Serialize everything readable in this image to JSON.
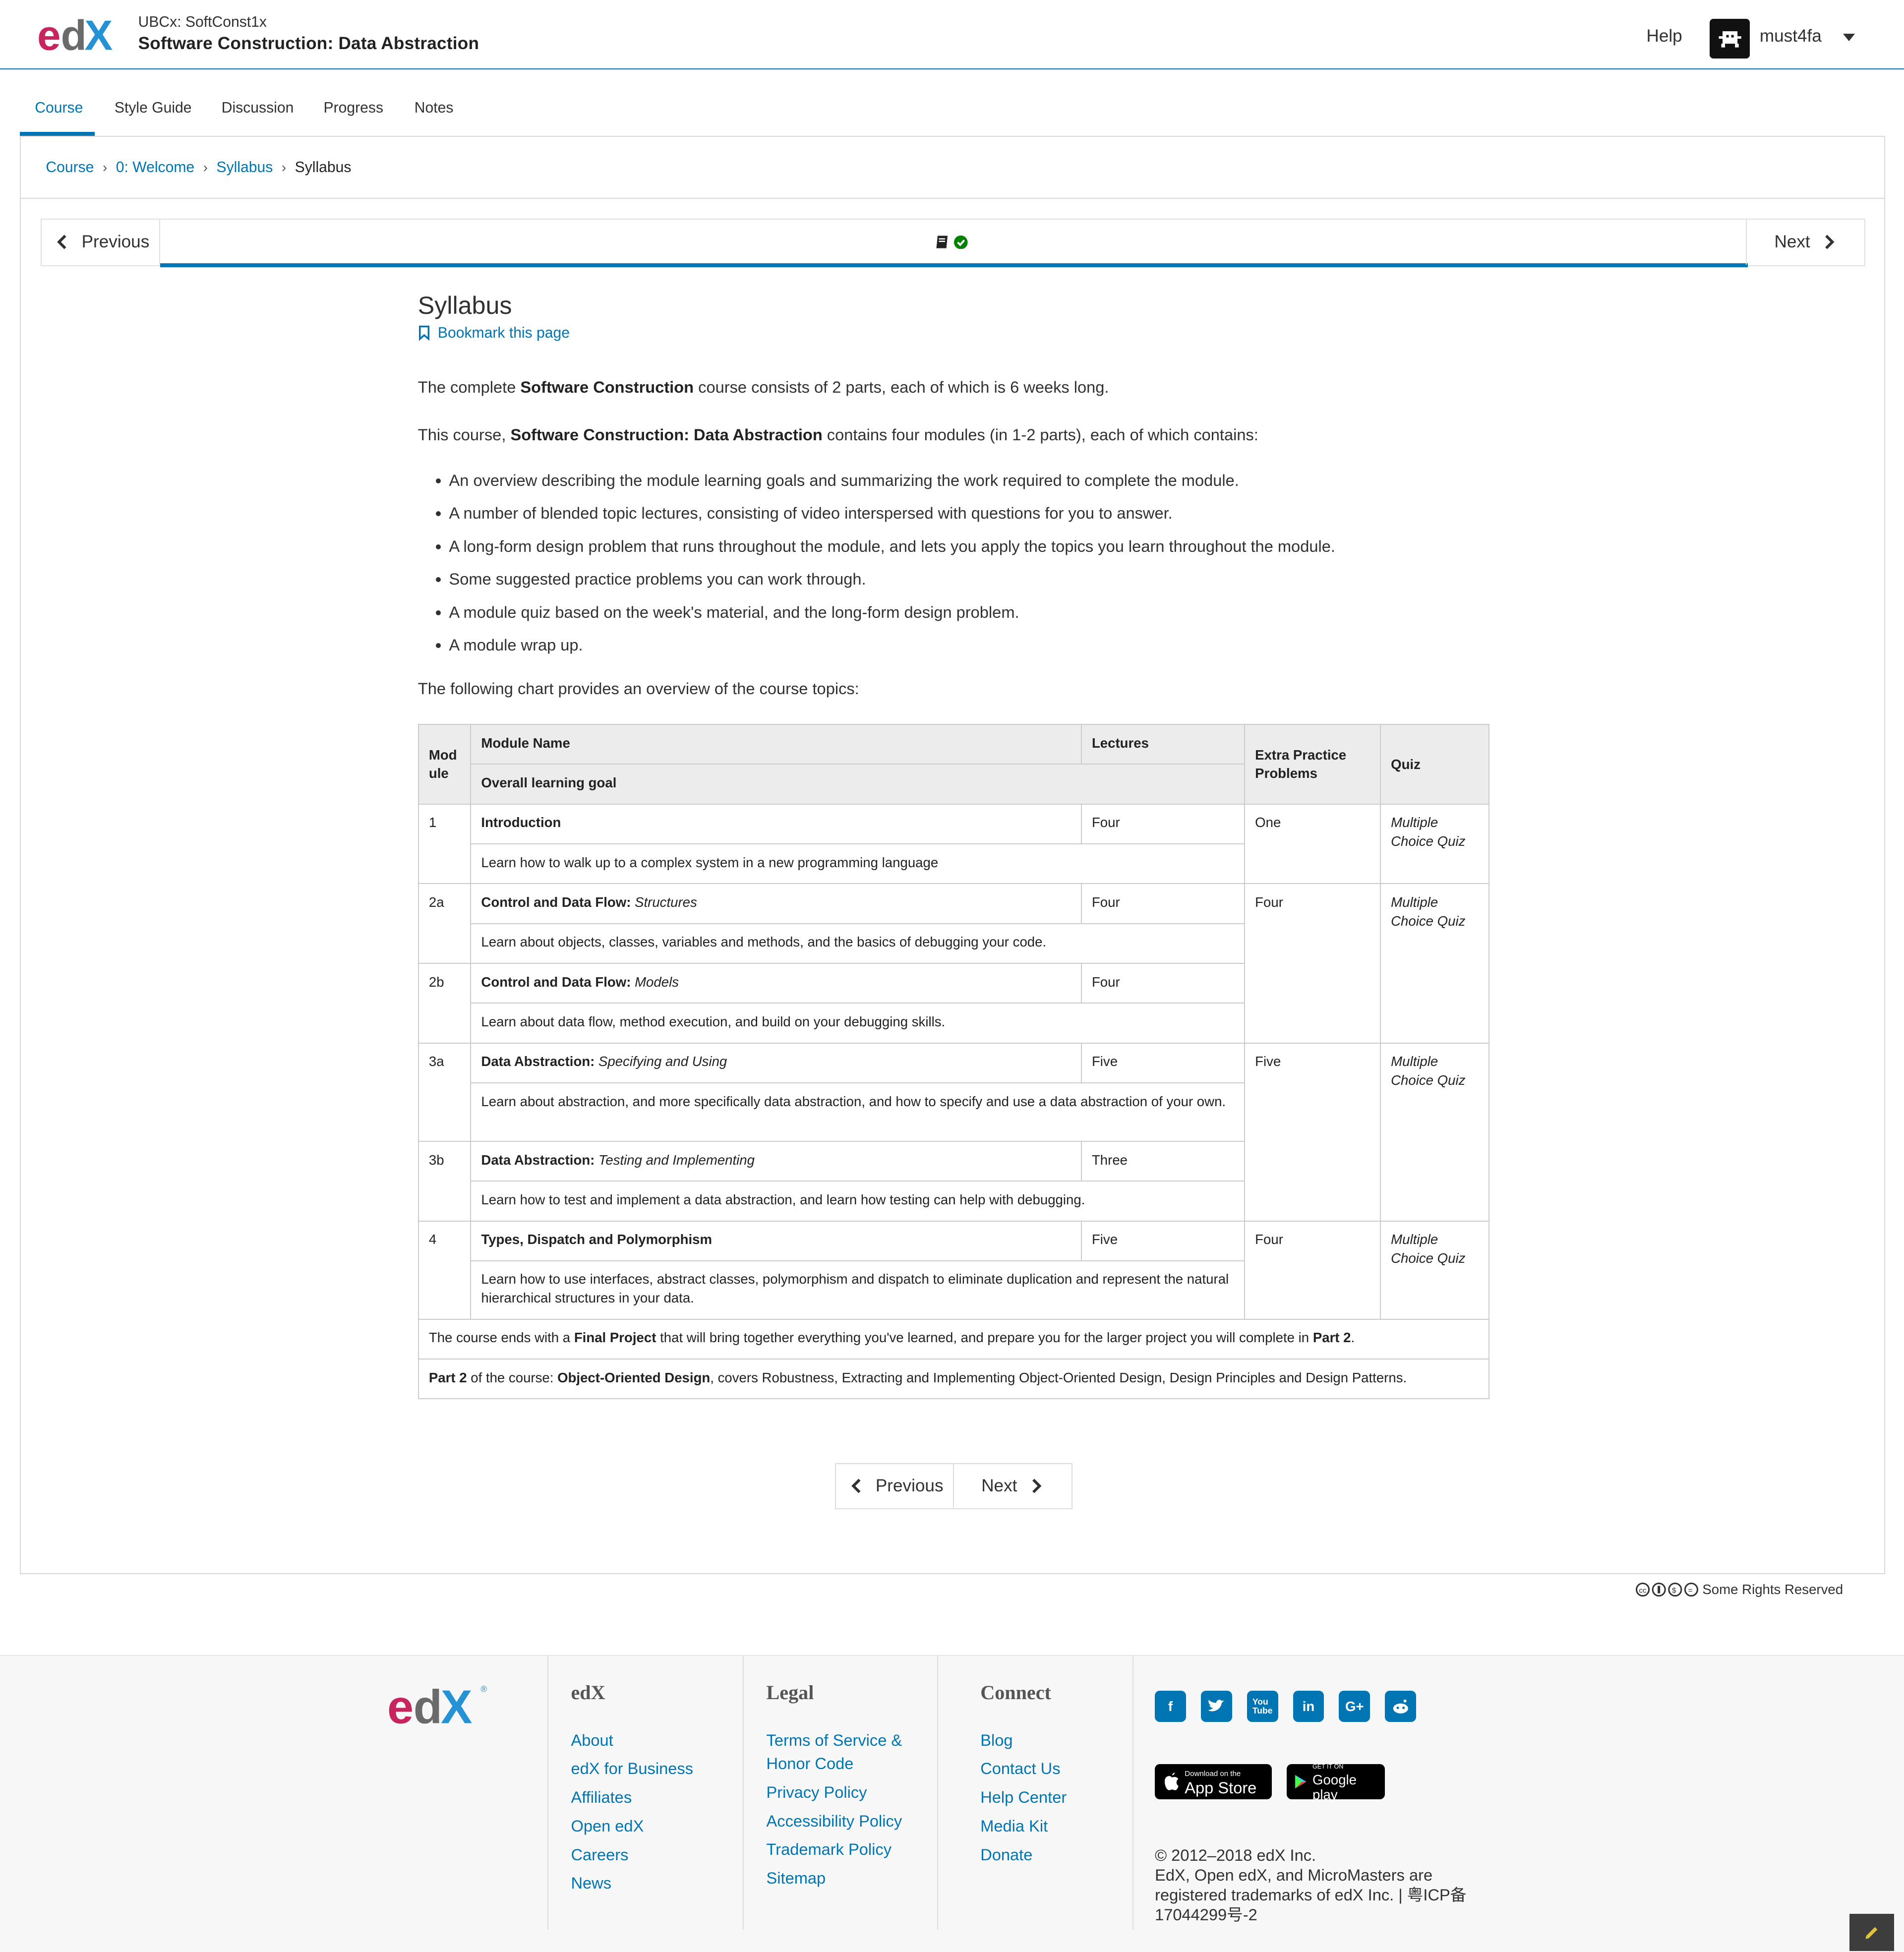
{
  "header": {
    "course_org": "UBCx: SoftConst1x",
    "course_title": "Software Construction: Data Abstraction",
    "help": "Help",
    "username": "must4fa"
  },
  "tabs": [
    "Course",
    "Style Guide",
    "Discussion",
    "Progress",
    "Notes"
  ],
  "breadcrumb": [
    "Course",
    "0: Welcome",
    "Syllabus",
    "Syllabus"
  ],
  "sequence_nav": {
    "previous": "Previous",
    "next": "Next"
  },
  "unit": {
    "title": "Syllabus",
    "bookmark": "Bookmark this page",
    "p1_pre": "The complete ",
    "p1_bold": "Software Construction",
    "p1_post": " course consists of 2 parts, each of which is 6 weeks long.",
    "p2_pre": "This course, ",
    "p2_bold": "Software Construction: Data Abstraction",
    "p2_post": " contains four modules (in 1-2 parts), each of which contains:",
    "bullets": [
      "An overview describing the module learning goals and summarizing the work required to complete the module.",
      "A number of blended topic lectures, consisting of video interspersed with questions for you to answer.",
      "A long-form design problem that runs throughout the module, and lets you apply the topics you learn throughout the module.",
      "Some suggested practice problems you can work through.",
      "A module quiz based on the week's material, and the long-form design problem.",
      "A module wrap up."
    ],
    "chart_intro": "The following chart provides an overview of the course topics:"
  },
  "table": {
    "headers": {
      "module": "Mod ule",
      "module_name": "Module Name",
      "lectures": "Lectures",
      "overall_goal": "Overall learning goal",
      "extra": "Extra Practice Problems",
      "quiz": "Quiz"
    },
    "rows": [
      {
        "mod": "1",
        "name_bold": "Introduction",
        "name_italic": "",
        "lectures": "Four",
        "goal": "Learn how to walk up to a complex system in a new programming language",
        "extra": "One",
        "quiz": "Multiple Choice Quiz"
      },
      {
        "mod": "2a",
        "name_bold": "Control and Data Flow: ",
        "name_italic": "Structures",
        "lectures": "Four",
        "goal": "Learn about objects, classes, variables and methods, and the basics of debugging your code.",
        "extra": "Four",
        "quiz": "Multiple Choice Quiz"
      },
      {
        "mod": "2b",
        "name_bold": "Control and Data Flow: ",
        "name_italic": "Models",
        "lectures": "Four",
        "goal": "Learn about data flow, method execution, and build on your debugging skills."
      },
      {
        "mod": "3a",
        "name_bold": "Data Abstraction: ",
        "name_italic": "Specifying and Using",
        "lectures": "Five",
        "goal": "Learn about abstraction, and more specifically data abstraction, and how to specify and use a data abstraction of your own.",
        "extra": "Five",
        "quiz": "Multiple Choice Quiz"
      },
      {
        "mod": "3b",
        "name_bold": "Data Abstraction: ",
        "name_italic": "Testing and Implementing",
        "lectures": "Three",
        "goal": "Learn how to test and implement a data abstraction, and learn how testing can help with debugging."
      },
      {
        "mod": "4",
        "name_bold": "Types, Dispatch and Polymorphism",
        "name_italic": "",
        "lectures": "Five",
        "goal": "Learn how to use interfaces, abstract classes, polymorphism and dispatch to eliminate duplication and represent the natural hierarchical structures in your data.",
        "extra": "Four",
        "quiz": "Multiple Choice Quiz"
      }
    ],
    "final_pre": "The course ends with a ",
    "final_bold": "Final Project",
    "final_mid": " that will bring together everything you've learned, and prepare you for the larger project you will complete in ",
    "final_bold2": "Part 2",
    "final_end": ".",
    "part2_bold": "Part 2",
    "part2_mid": " of the course: ",
    "part2_bold2": "Object-Oriented Design",
    "part2_end": ", covers Robustness, Extracting and Implementing Object-Oriented Design, Design Principles and Design Patterns."
  },
  "bottom_nav": {
    "previous": "Previous",
    "next": "Next"
  },
  "license": "Some Rights Reserved",
  "footer": {
    "col_edx": {
      "title": "edX",
      "links": [
        "About",
        "edX for Business",
        "Affiliates",
        "Open edX",
        "Careers",
        "News"
      ]
    },
    "col_legal": {
      "title": "Legal",
      "links": [
        "Terms of Service & Honor Code",
        "Privacy Policy",
        "Accessibility Policy",
        "Trademark Policy",
        "Sitemap"
      ]
    },
    "col_connect": {
      "title": "Connect",
      "links": [
        "Blog",
        "Contact Us",
        "Help Center",
        "Media Kit",
        "Donate"
      ]
    },
    "social_icons": [
      "facebook-icon",
      "twitter-icon",
      "youtube-icon",
      "linkedin-icon",
      "google-plus-icon",
      "reddit-icon"
    ],
    "app_store_small": "Download on the",
    "app_store": "App Store",
    "google_play_small": "GET IT ON",
    "google_play": "Google play",
    "copyright": "© 2012–2018 edX Inc.",
    "trademark": "EdX, Open edX, and MicroMasters are registered trademarks of edX Inc. | 粤ICP备17044299号-2"
  },
  "colors": {
    "accent": "#0075b4",
    "logo_pink": "#c8255e",
    "logo_blue": "#2592d5",
    "logo_gray": "#6a6a6a"
  }
}
